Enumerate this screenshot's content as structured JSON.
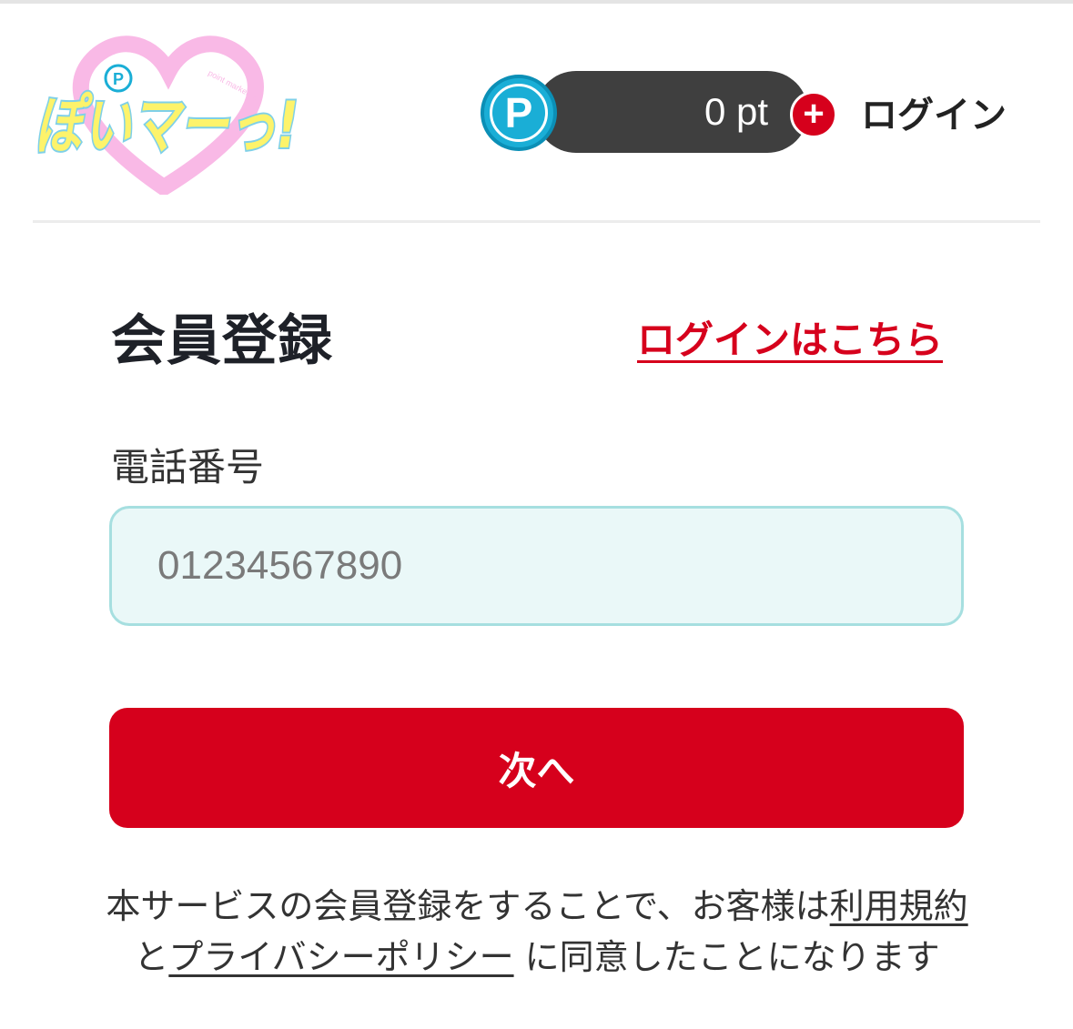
{
  "header": {
    "logo_text": "ぽいマーっ!",
    "logo_small_text": "point marketing",
    "points_icon_letter": "P",
    "points_value": "0 pt",
    "add_points_symbol": "+",
    "login_label": "ログイン"
  },
  "form": {
    "title": "会員登録",
    "login_here_label": "ログインはこちら",
    "phone_label": "電話番号",
    "phone_placeholder": "01234567890",
    "phone_value": "",
    "next_button_label": "次へ"
  },
  "terms": {
    "prefix": "本サービスの会員登録をすることで、お客様は",
    "terms_link": "利用規約",
    "middle": "と",
    "privacy_link": "プライバシーポリシー",
    "suffix": " に同意したことになります"
  },
  "colors": {
    "brand_red": "#d6001c",
    "points_blue": "#1aaed6",
    "input_bg": "#eaf8f8",
    "input_border": "#a6dfe0",
    "logo_pink": "#f9b9e6",
    "logo_yellow": "#fdf36b"
  }
}
